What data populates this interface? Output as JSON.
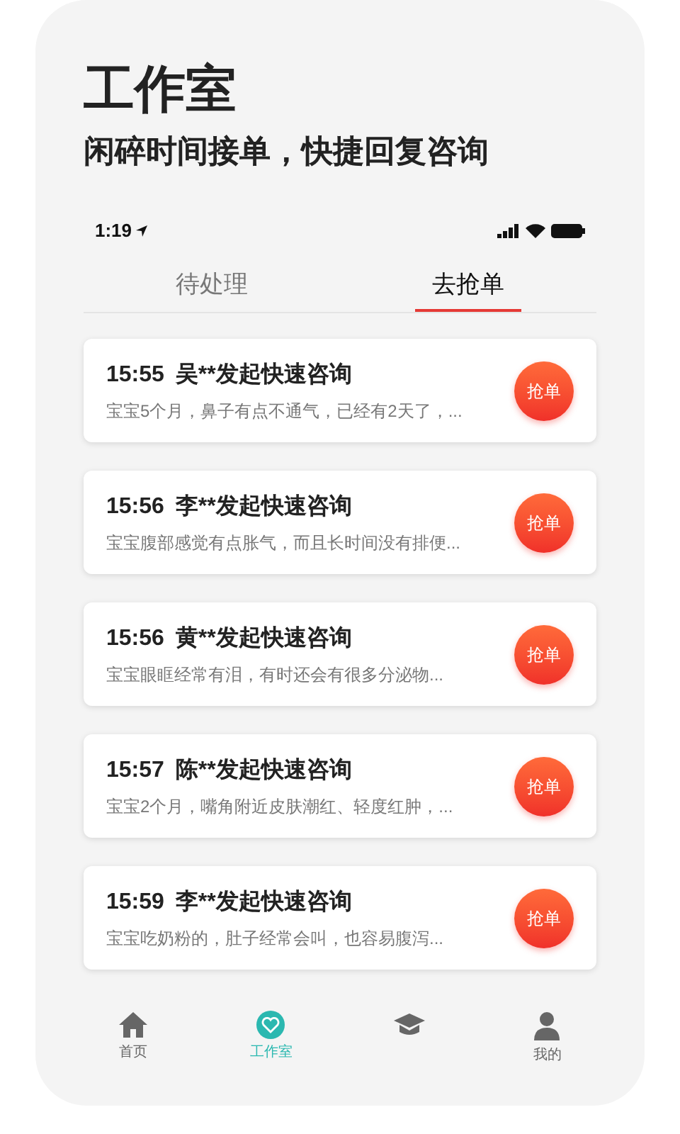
{
  "headline": {
    "title": "工作室",
    "subtitle": "闲碎时间接单，快捷回复咨询"
  },
  "status_bar": {
    "time": "1:19"
  },
  "tabs": [
    {
      "label": "待处理",
      "selected": false
    },
    {
      "label": "去抢单",
      "selected": true
    }
  ],
  "orders": [
    {
      "time": "15:55",
      "title": "吴**发起快速咨询",
      "summary": "宝宝5个月，鼻子有点不通气，已经有2天了，...",
      "button": "抢单"
    },
    {
      "time": "15:56",
      "title": "李**发起快速咨询",
      "summary": "宝宝腹部感觉有点胀气，而且长时间没有排便...",
      "button": "抢单"
    },
    {
      "time": "15:56",
      "title": "黄**发起快速咨询",
      "summary": "宝宝眼眶经常有泪，有时还会有很多分泌物...",
      "button": "抢单"
    },
    {
      "time": "15:57",
      "title": "陈**发起快速咨询",
      "summary": "宝宝2个月，嘴角附近皮肤潮红、轻度红肿，...",
      "button": "抢单"
    },
    {
      "time": "15:59",
      "title": "李**发起快速咨询",
      "summary": "宝宝吃奶粉的，肚子经常会叫，也容易腹泻...",
      "button": "抢单"
    }
  ],
  "bottom_nav": [
    {
      "kind": "home",
      "label": "首页",
      "selected": false
    },
    {
      "kind": "studio",
      "label": "工作室",
      "selected": true
    },
    {
      "kind": "school",
      "selected": false
    },
    {
      "kind": "profile",
      "label": "我的",
      "selected": false
    }
  ]
}
